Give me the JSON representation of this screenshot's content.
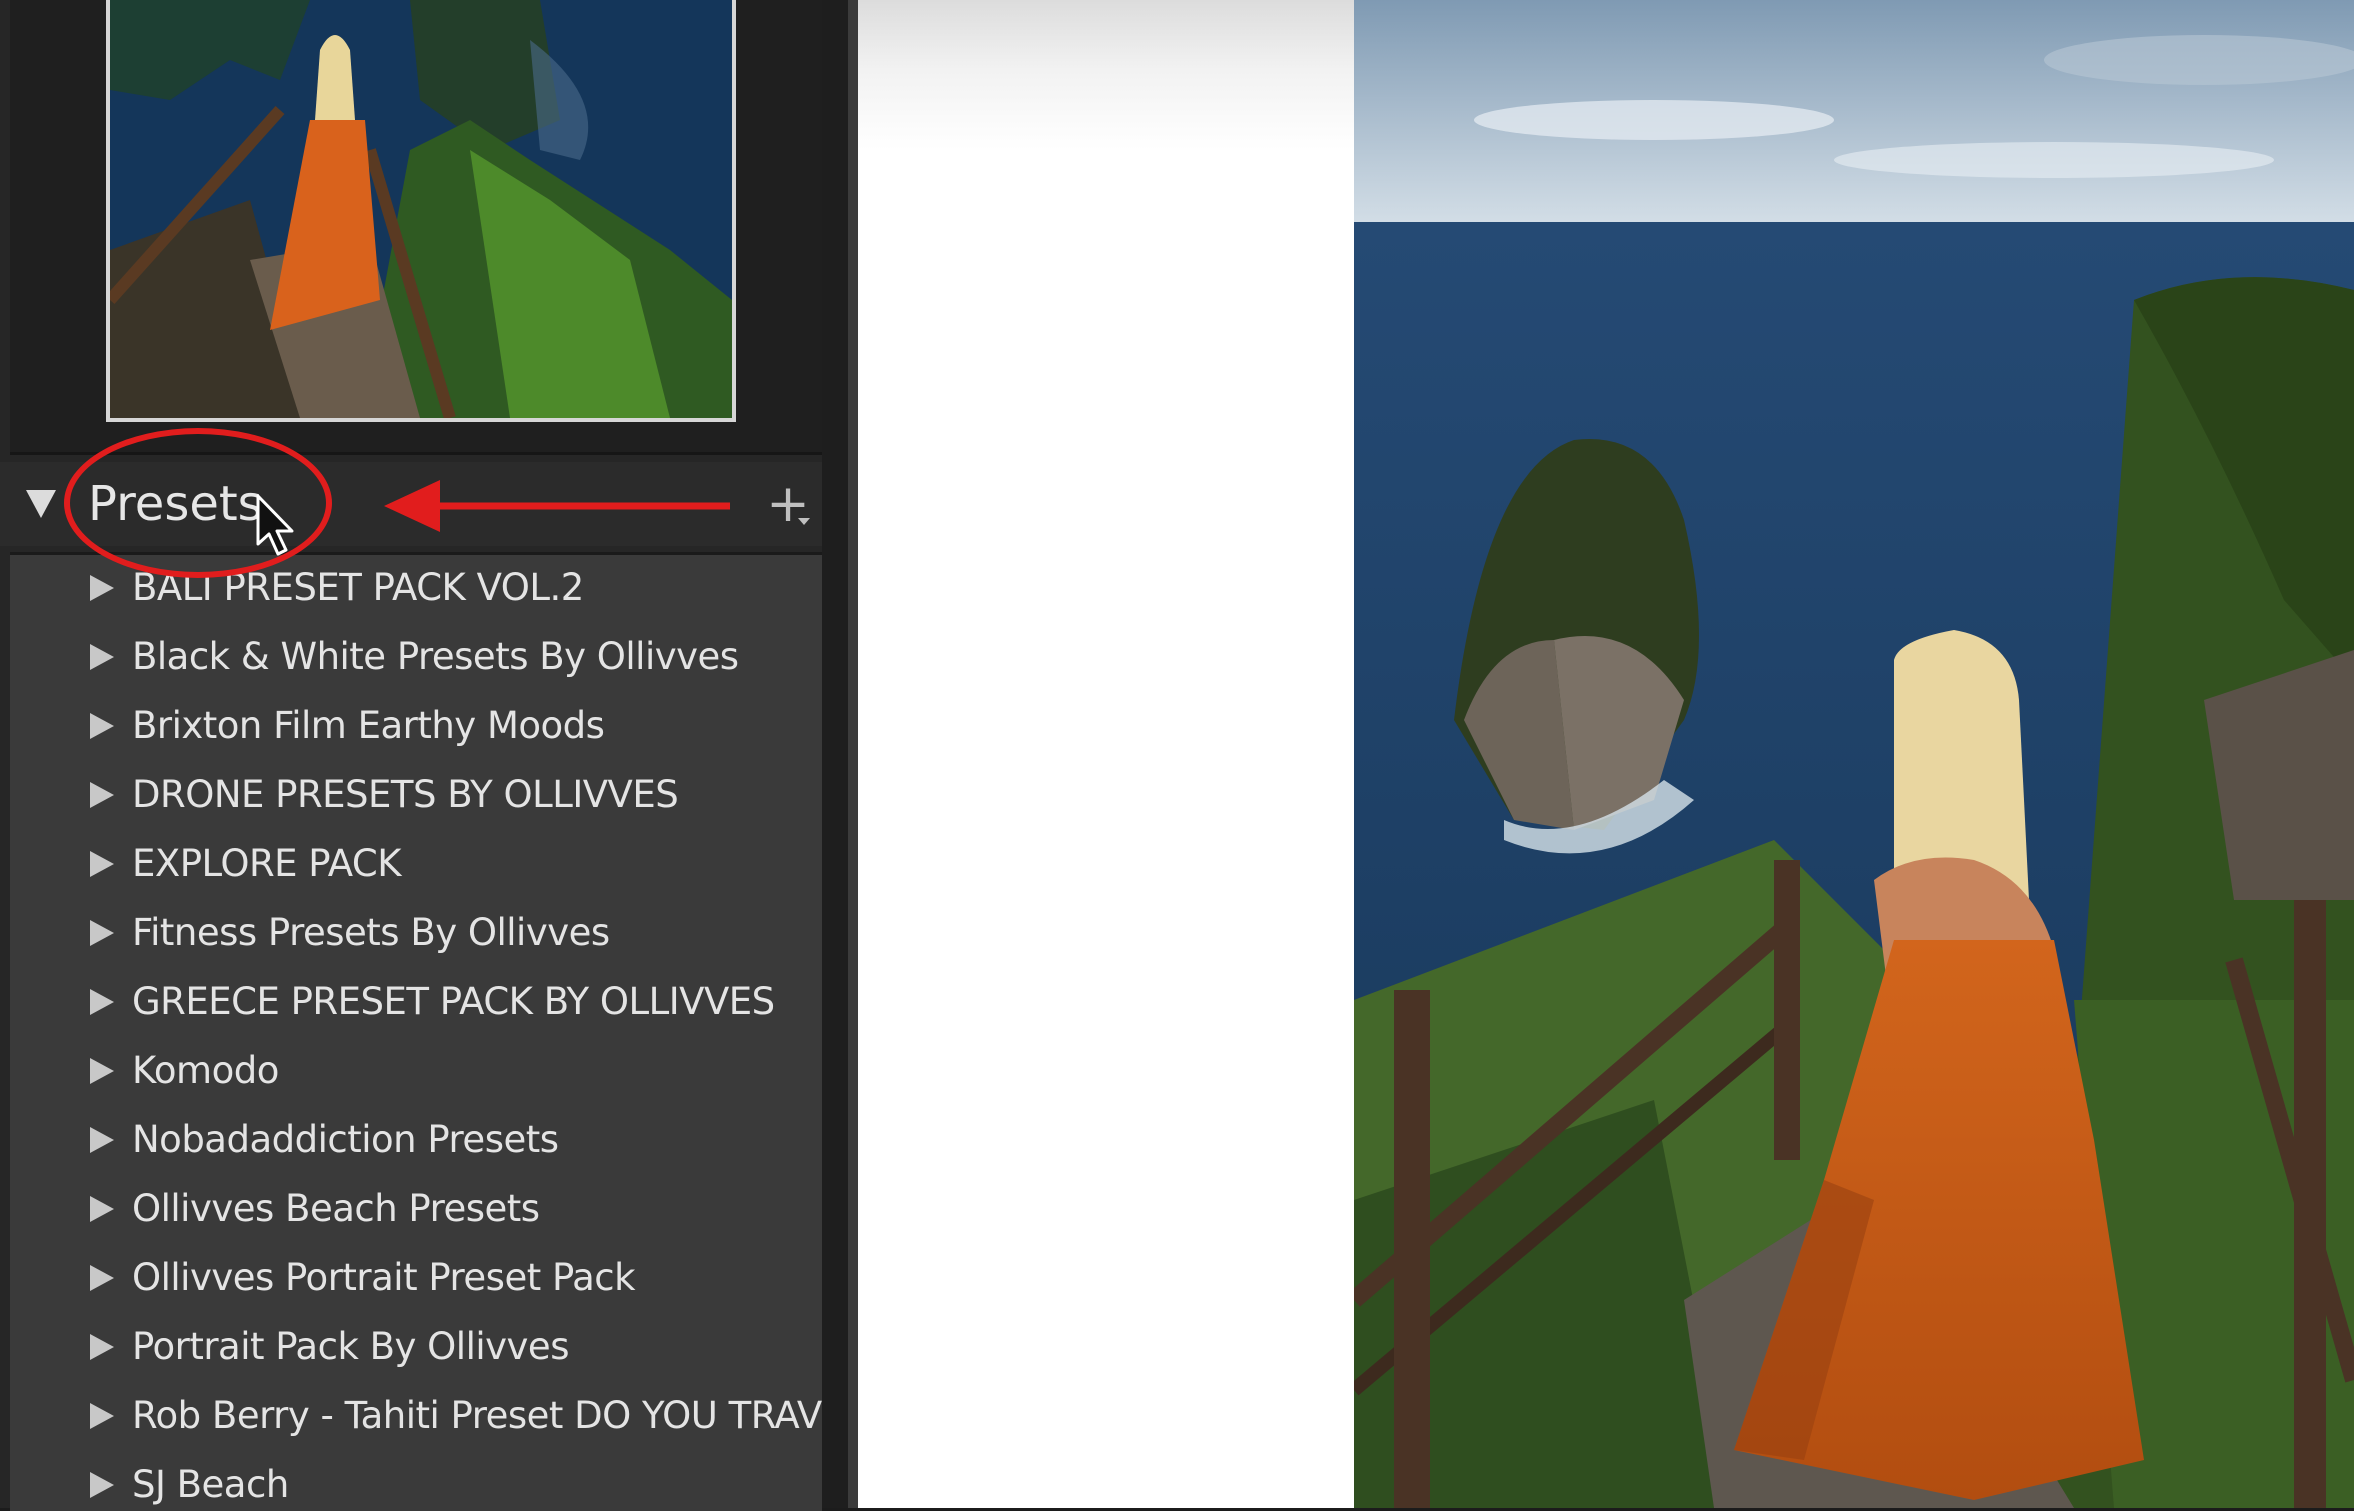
{
  "panel": {
    "title": "Presets",
    "add_symbol": "+"
  },
  "presets": [
    {
      "label": "BALI PRESET PACK VOL.2"
    },
    {
      "label": "Black & White Presets By Ollivves"
    },
    {
      "label": "Brixton Film Earthy Moods"
    },
    {
      "label": "DRONE PRESETS BY OLLIVVES"
    },
    {
      "label": "EXPLORE PACK"
    },
    {
      "label": "Fitness Presets By Ollivves"
    },
    {
      "label": "GREECE PRESET PACK BY OLLIVVES"
    },
    {
      "label": "Komodo"
    },
    {
      "label": "Nobadaddiction Presets"
    },
    {
      "label": "Ollivves Beach Presets"
    },
    {
      "label": "Ollivves Portrait Preset Pack"
    },
    {
      "label": "Portrait Pack By Ollivves"
    },
    {
      "label": "Rob Berry - Tahiti Preset DO YOU TRAVEL_"
    },
    {
      "label": "SJ Beach"
    }
  ],
  "colors": {
    "annotation": "#e11d1d",
    "panel_bg": "#3a3a3a",
    "text": "#e4e4e4"
  }
}
